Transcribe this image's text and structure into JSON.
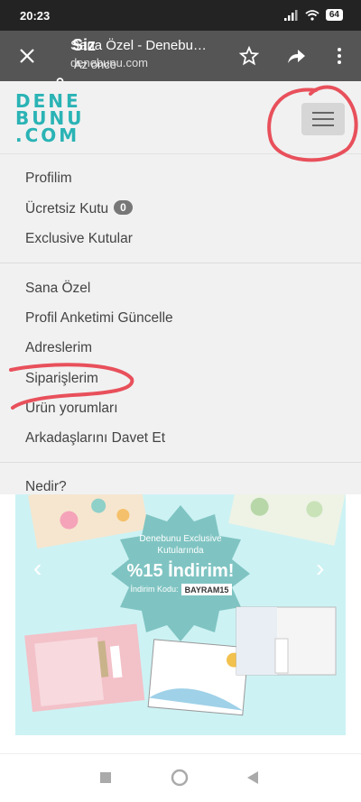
{
  "status_bar": {
    "time": "20:23",
    "battery": "64"
  },
  "browser": {
    "page_title": "Sana Özel - Denebu…",
    "url": "denebunu.com",
    "overlay_title": "Siz",
    "overlay_subtitle": "Az önce"
  },
  "logo": {
    "line1": "DENE",
    "line2": "BUNU",
    "line3": ".COM"
  },
  "menu": {
    "items_group1": [
      {
        "label": "Profilim"
      },
      {
        "label": "Ücretsiz Kutu",
        "badge": "0"
      },
      {
        "label": "Exclusive Kutular"
      }
    ],
    "items_group2": [
      {
        "label": "Sana Özel"
      },
      {
        "label": "Profil Anketimi Güncelle"
      },
      {
        "label": "Adreslerim"
      },
      {
        "label": "Siparişlerim"
      },
      {
        "label": "Ürün yorumları"
      },
      {
        "label": "Arkadaşlarını Davet Et"
      }
    ],
    "partial_item": "Nedir?"
  },
  "banner": {
    "line1": "Denebunu Exclusive",
    "line2": "Kutularında",
    "discount": "%15 İndirim!",
    "code_label": "İndirim Kodu:",
    "code": "BAYRAM15",
    "prev": "‹",
    "next": "›"
  },
  "colors": {
    "brand_teal": "#2ab3b5",
    "annotation_red": "#e8505b",
    "toolbar": "#555555"
  }
}
